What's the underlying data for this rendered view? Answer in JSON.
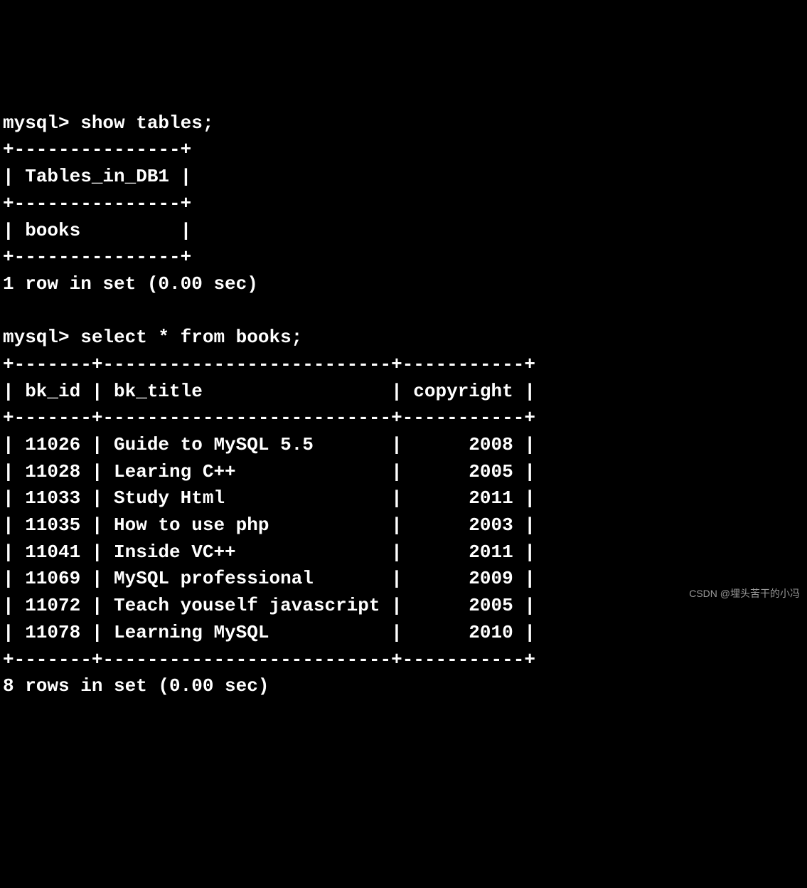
{
  "session": {
    "prompt": "mysql> ",
    "cmd1": "show tables;",
    "table1_border": "+---------------+",
    "table1_header": "| Tables_in_DB1 |",
    "table1_row1": "| books         |",
    "result1_status": "1 row in set (0.00 sec)",
    "cmd2": "select * from books;",
    "table2_border": "+-------+--------------------------+-----------+",
    "table2_header": "| bk_id | bk_title                 | copyright |",
    "result2_status": "8 rows in set (0.00 sec)",
    "books": [
      "| 11026 | Guide to MySQL 5.5       |      2008 |",
      "| 11028 | Learing C++              |      2005 |",
      "| 11033 | Study Html               |      2011 |",
      "| 11035 | How to use php           |      2003 |",
      "| 11041 | Inside VC++              |      2011 |",
      "| 11069 | MySQL professional       |      2009 |",
      "| 11072 | Teach youself javascript |      2005 |",
      "| 11078 | Learning MySQL           |      2010 |"
    ]
  },
  "watermark": "CSDN @埋头苦干的小冯"
}
